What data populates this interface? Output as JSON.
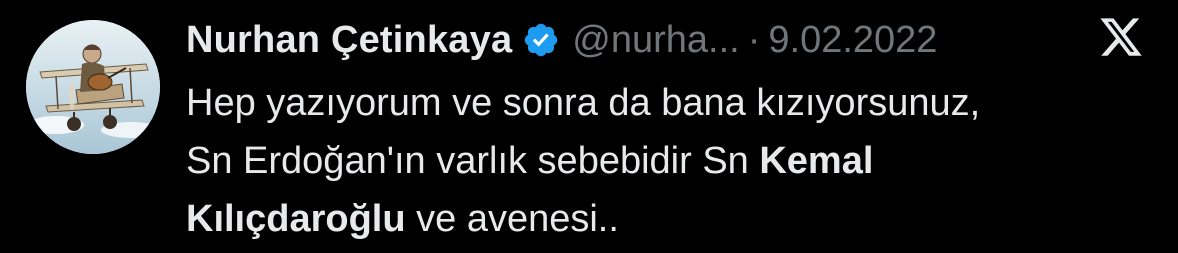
{
  "tweet": {
    "author_name": "Nurhan Çetinkaya",
    "handle": "@nurha...",
    "separator": "·",
    "date": "9.02.2022",
    "verified_icon": "verified-badge-icon",
    "platform_icon": "x-logo-icon",
    "text": {
      "line1": "Hep yazıyorum ve sonra da bana kızıyorsunuz,",
      "line2_plain": "Sn Erdoğan'ın varlık sebebidir Sn ",
      "line2_bold": "Kemal",
      "line3_bold": "Kılıçdaroğlu",
      "line3_plain": " ve avenesi.."
    }
  },
  "colors": {
    "background": "#000000",
    "text_primary": "#e7e9ea",
    "text_secondary": "#71767b",
    "verified": "#1d9bf0"
  }
}
